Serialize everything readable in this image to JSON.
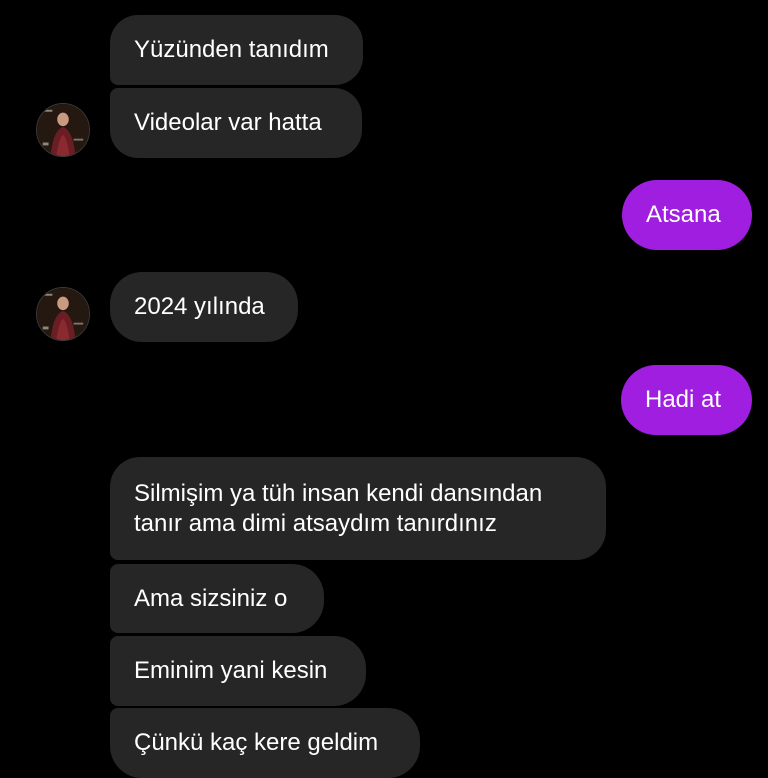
{
  "conversation": {
    "messages": [
      {
        "id": "m1",
        "direction": "incoming",
        "text": "Yüzünden tanıdım"
      },
      {
        "id": "m2",
        "direction": "incoming",
        "text": "Videolar var hatta"
      },
      {
        "id": "m3",
        "direction": "outgoing",
        "text": "Atsana"
      },
      {
        "id": "m4",
        "direction": "incoming",
        "text": "2024 yılında"
      },
      {
        "id": "m5",
        "direction": "outgoing",
        "text": "Hadi at"
      },
      {
        "id": "m6",
        "direction": "incoming",
        "text": "Silmişim ya tüh insan kendi dansından tanır ama dimi atsaydım tanırdınız"
      },
      {
        "id": "m7",
        "direction": "incoming",
        "text": "Ama sizsiniz o"
      },
      {
        "id": "m8",
        "direction": "incoming",
        "text": "Eminim yani kesin"
      },
      {
        "id": "m9",
        "direction": "incoming",
        "text": "Çünkü kaç kere geldim"
      }
    ]
  },
  "colors": {
    "background": "#000000",
    "incoming_bubble": "#262626",
    "outgoing_bubble": "#a01ee0",
    "text": "#ffffff"
  },
  "icons": {
    "contact_avatar": "contact-avatar-photo"
  }
}
